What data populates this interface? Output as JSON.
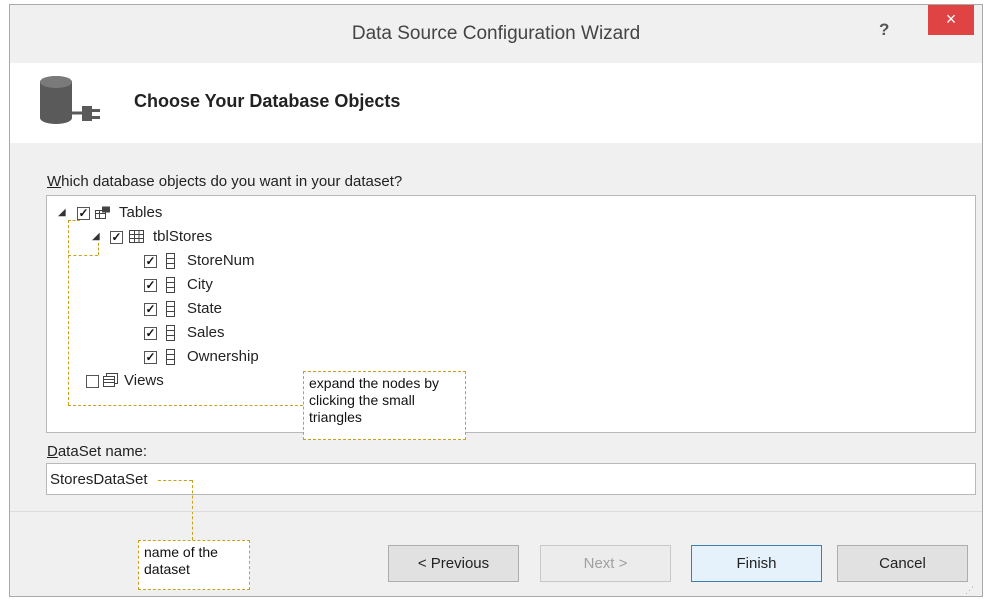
{
  "window": {
    "title": "Data Source Configuration Wizard",
    "help_label": "?",
    "close_label": "×"
  },
  "header": {
    "heading": "Choose Your Database Objects"
  },
  "tree": {
    "question": "Which database objects do you want in your dataset?",
    "tables_label": "Tables",
    "table_label": "tblStores",
    "columns": [
      "StoreNum",
      "City",
      "State",
      "Sales",
      "Ownership"
    ],
    "views_label": "Views"
  },
  "dataset": {
    "label": "DataSet name:",
    "value": "StoresDataSet"
  },
  "buttons": {
    "previous": "< Previous",
    "next": "Next >",
    "finish": "Finish",
    "cancel": "Cancel"
  },
  "callouts": {
    "expand_nodes": "expand the nodes by clicking the small triangles",
    "name_of_dataset": "name of the dataset"
  },
  "colors": {
    "close_button": "#e04343",
    "callout_border": "#c9a21c"
  }
}
